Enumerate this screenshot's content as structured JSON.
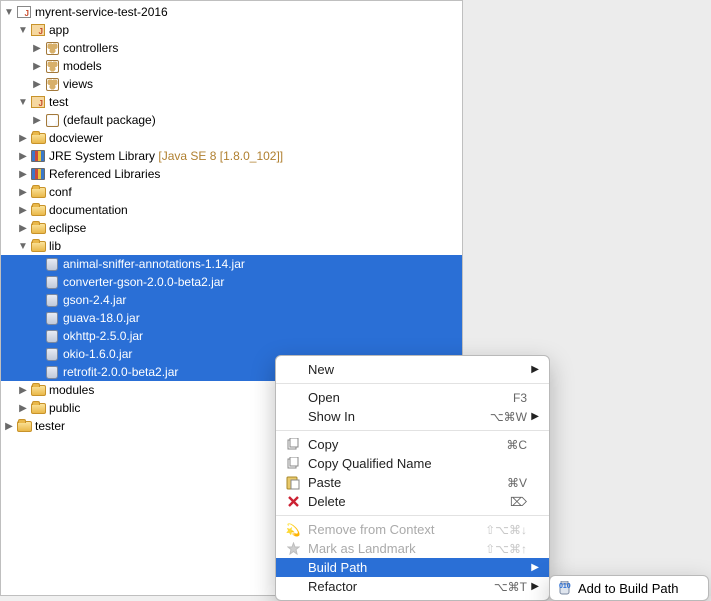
{
  "tree": {
    "root": "myrent-service-test-2016",
    "app": "app",
    "controllers": "controllers",
    "models": "models",
    "views": "views",
    "test": "test",
    "default_pkg": "(default package)",
    "docviewer": "docviewer",
    "jre": "JRE System Library",
    "jre_hint": "[Java SE 8 [1.8.0_102]]",
    "ref_libs": "Referenced Libraries",
    "conf": "conf",
    "documentation": "documentation",
    "eclipse": "eclipse",
    "lib": "lib",
    "jars": [
      "animal-sniffer-annotations-1.14.jar",
      "converter-gson-2.0.0-beta2.jar",
      "gson-2.4.jar",
      "guava-18.0.jar",
      "okhttp-2.5.0.jar",
      "okio-1.6.0.jar",
      "retrofit-2.0.0-beta2.jar"
    ],
    "modules": "modules",
    "public": "public",
    "tester": "tester"
  },
  "menu": {
    "new": "New",
    "open": "Open",
    "open_key": "F3",
    "show_in": "Show In",
    "show_in_key": "⌥⌘W",
    "copy": "Copy",
    "copy_key": "⌘C",
    "copy_qn": "Copy Qualified Name",
    "paste": "Paste",
    "paste_key": "⌘V",
    "delete": "Delete",
    "delete_key": "⌦",
    "remove_ctx": "Remove from Context",
    "remove_ctx_key": "⇧⌥⌘↓",
    "mark_lm": "Mark as Landmark",
    "mark_lm_key": "⇧⌥⌘↑",
    "build_path": "Build Path",
    "refactor": "Refactor",
    "refactor_key": "⌥⌘T"
  },
  "submenu": {
    "add_bp": "Add to Build Path"
  }
}
